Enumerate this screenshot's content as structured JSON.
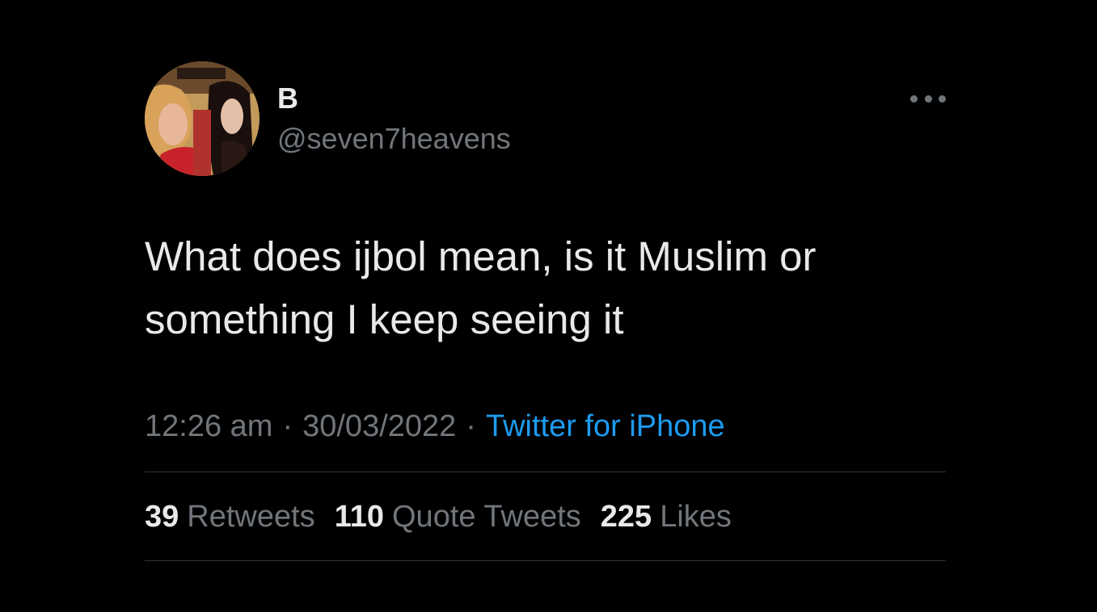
{
  "user": {
    "display_name": "B",
    "handle": "@seven7heavens",
    "avatar": "profile-photo"
  },
  "tweet": {
    "text": "What does ijbol mean, is it Muslim or\nsomething I keep seeing it",
    "time": "12:26 am",
    "separator": "·",
    "date": "30/03/2022",
    "source": "Twitter for iPhone"
  },
  "stats": {
    "retweets_count": "39",
    "retweets_label": "Retweets",
    "quotes_count": "110",
    "quotes_label": "Quote Tweets",
    "likes_count": "225",
    "likes_label": "Likes"
  },
  "more_menu_icon": "more-horizontal-icon",
  "colors": {
    "background": "#000000",
    "text_primary": "#e7e9ea",
    "text_secondary": "#71767b",
    "link": "#1d9bf0",
    "divider": "#2f3336"
  }
}
